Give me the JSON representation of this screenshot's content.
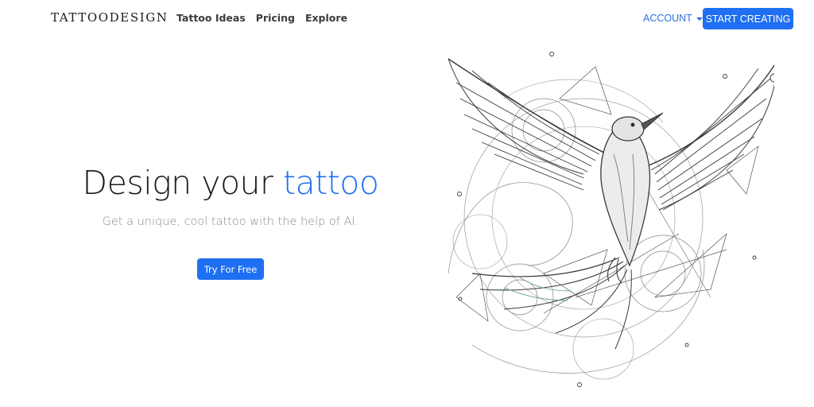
{
  "nav": {
    "brand": "TATTOODESIGN",
    "links": [
      "Tattoo Ideas",
      "Pricing",
      "Explore"
    ],
    "account_label": "ACCOUNT",
    "start_label": "START CREATING"
  },
  "hero": {
    "title_prefix": "Design your ",
    "title_accent": "tattoo",
    "subtitle": "Get a unique, cool tattoo with the help of AI.",
    "cta_label": "Try For Free"
  },
  "colors": {
    "accent": "#1f6ff2",
    "text": "#1c1c1c",
    "muted": "#8a8a8a",
    "background": "#ffffff"
  },
  "icons": {
    "account_caret": "caret-down-icon"
  }
}
